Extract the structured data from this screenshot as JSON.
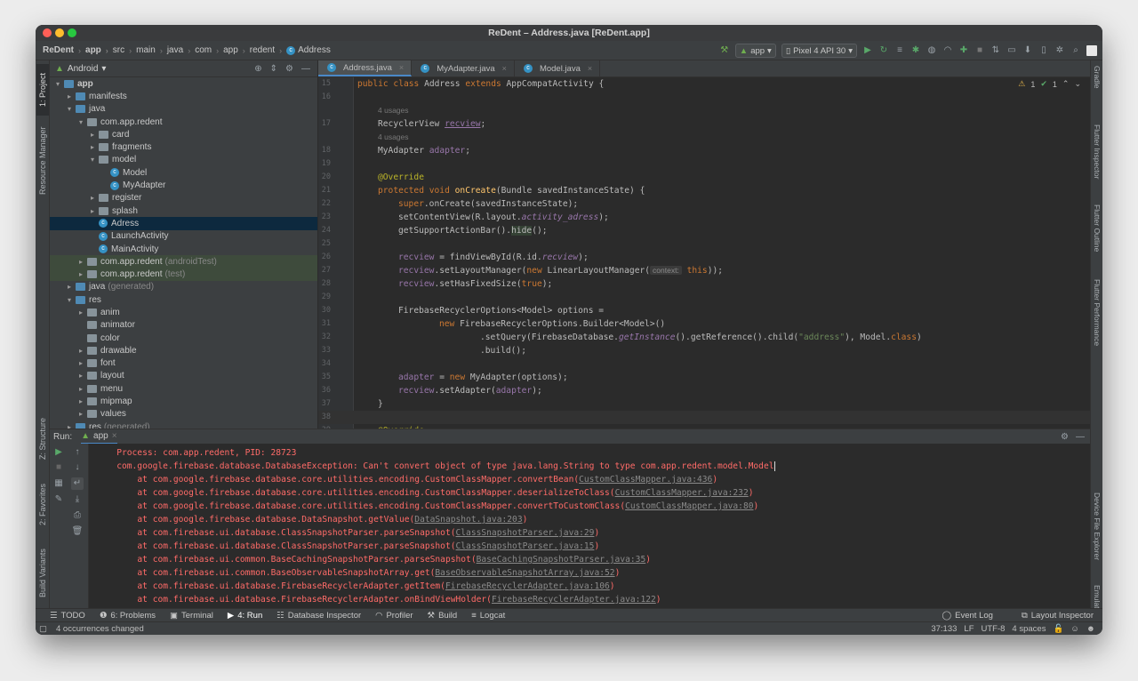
{
  "window": {
    "title": "ReDent – Address.java [ReDent.app]",
    "colors": {
      "close": "#ff5f57",
      "minimize": "#febc2e",
      "maximize": "#28c840",
      "accent": "#4a88c7",
      "error_text": "#ff6b68"
    }
  },
  "breadcrumbs": [
    "ReDent",
    "app",
    "src",
    "main",
    "java",
    "com",
    "app",
    "redent",
    "Address"
  ],
  "toolbar": {
    "run_config": "app",
    "device": "Pixel 4 API 30"
  },
  "left_stripe": {
    "tabs": [
      "1: Project",
      "Resource Manager",
      "Z: Structure",
      "2: Favorites",
      "Build Variants"
    ]
  },
  "right_stripe": {
    "tabs": [
      "Gradle",
      "Flutter Inspector",
      "Flutter Outline",
      "Flutter Performance",
      "Device File Explorer",
      "Emulator"
    ]
  },
  "project": {
    "view": "Android",
    "tree": [
      {
        "label": "app",
        "suffix": ""
      },
      {
        "label": "manifests",
        "suffix": ""
      },
      {
        "label": "java",
        "suffix": ""
      },
      {
        "label": "com.app.redent",
        "suffix": ""
      },
      {
        "label": "card",
        "suffix": ""
      },
      {
        "label": "fragments",
        "suffix": ""
      },
      {
        "label": "model",
        "suffix": ""
      },
      {
        "label": "Model",
        "suffix": ""
      },
      {
        "label": "MyAdapter",
        "suffix": ""
      },
      {
        "label": "register",
        "suffix": ""
      },
      {
        "label": "splash",
        "suffix": ""
      },
      {
        "label": "Adress",
        "suffix": ""
      },
      {
        "label": "LaunchActivity",
        "suffix": ""
      },
      {
        "label": "MainActivity",
        "suffix": ""
      },
      {
        "label": "com.app.redent",
        "suffix": "(androidTest)"
      },
      {
        "label": "com.app.redent",
        "suffix": "(test)"
      },
      {
        "label": "java",
        "suffix": "(generated)"
      },
      {
        "label": "res",
        "suffix": ""
      },
      {
        "label": "anim",
        "suffix": ""
      },
      {
        "label": "animator",
        "suffix": ""
      },
      {
        "label": "color",
        "suffix": ""
      },
      {
        "label": "drawable",
        "suffix": ""
      },
      {
        "label": "font",
        "suffix": ""
      },
      {
        "label": "layout",
        "suffix": ""
      },
      {
        "label": "menu",
        "suffix": ""
      },
      {
        "label": "mipmap",
        "suffix": ""
      },
      {
        "label": "values",
        "suffix": ""
      },
      {
        "label": "res",
        "suffix": "(generated)"
      }
    ]
  },
  "editor_tabs": [
    "Address.java",
    "MyAdapter.java",
    "Model.java"
  ],
  "inspections": {
    "warnings": "1",
    "ok": "1"
  },
  "code": {
    "line_numbers": [
      "15",
      "16",
      "",
      "17",
      "",
      "18",
      "19",
      "20",
      "21",
      "22",
      "23",
      "24",
      "25",
      "26",
      "27",
      "28",
      "29",
      "30",
      "31",
      "32",
      "33",
      "34",
      "35",
      "36",
      "37",
      "38",
      "39"
    ],
    "usages_4": "4 usages",
    "l15": {
      "kw1": "public class",
      "name": "Address",
      "kw2": "extends",
      "rest": "AppCompatActivity {"
    },
    "l17": {
      "type": "RecyclerView",
      "field": "recview",
      "end": ";"
    },
    "l18": {
      "type": "MyAdapter",
      "field": "adapter",
      "end": ";"
    },
    "l20": "@Override",
    "l21": {
      "kw": "protected void",
      "fn": "onCreate",
      "rest": "(Bundle savedInstanceState) {"
    },
    "l22": {
      "kw": "super",
      "rest": ".onCreate(savedInstanceState);"
    },
    "l23": {
      "a": "setContentView(R.layout.",
      "b": "activity_adress",
      "c": ");"
    },
    "l24": {
      "a": "getSupportActionBar().",
      "b": "hide",
      "c": "();"
    },
    "l26": {
      "f": "recview",
      "a": " = findViewById(R.id.",
      "b": "recview",
      "c": ");"
    },
    "l27": {
      "f": "recview",
      "a": ".setLayoutManager(",
      "kw": "new",
      "b": " LinearLayoutManager(",
      "hint": "context:",
      "kw2": "this",
      "c": "));"
    },
    "l28": {
      "f": "recview",
      "a": ".setHasFixedSize(",
      "kw": "true",
      "c": ");"
    },
    "l30": {
      "a": "FirebaseRecyclerOptions<Model> options ="
    },
    "l31": {
      "kw": "new",
      "a": " FirebaseRecyclerOptions.Builder<Model>()"
    },
    "l32": {
      "a": ".setQuery(FirebaseDatabase.",
      "b": "getInstance",
      "c": "().getReference().child(",
      "s": "\"address\"",
      "d": "), Model.",
      "kw": "class",
      "e": ")"
    },
    "l33": ".build();",
    "l35": {
      "f": "adapter",
      "a": " = ",
      "kw": "new",
      "b": " MyAdapter(options);"
    },
    "l36": {
      "f": "recview",
      "a": ".setAdapter(",
      "g": "adapter",
      "c": ");"
    },
    "l37": "}",
    "l39": "@Override"
  },
  "run": {
    "label": "Run:",
    "tab": "app",
    "lines": [
      {
        "text": "Process: com.app.redent, PID: 28723",
        "link": "",
        "tail": "",
        "indent": "    "
      },
      {
        "text": "com.google.firebase.database.DatabaseException: Can't convert object of type java.lang.String to type com.app.redent.model.Model",
        "link": "",
        "tail": "",
        "indent": "    "
      },
      {
        "text": "at com.google.firebase.database.core.utilities.encoding.CustomClassMapper.convertBean(",
        "link": "CustomClassMapper.java:436",
        "tail": ")",
        "indent": "        "
      },
      {
        "text": "at com.google.firebase.database.core.utilities.encoding.CustomClassMapper.deserializeToClass(",
        "link": "CustomClassMapper.java:232",
        "tail": ")",
        "indent": "        "
      },
      {
        "text": "at com.google.firebase.database.core.utilities.encoding.CustomClassMapper.convertToCustomClass(",
        "link": "CustomClassMapper.java:80",
        "tail": ")",
        "indent": "        "
      },
      {
        "text": "at com.google.firebase.database.DataSnapshot.getValue(",
        "link": "DataSnapshot.java:203",
        "tail": ")",
        "indent": "        "
      },
      {
        "text": "at com.firebase.ui.database.ClassSnapshotParser.parseSnapshot(",
        "link": "ClassSnapshotParser.java:29",
        "tail": ")",
        "indent": "        "
      },
      {
        "text": "at com.firebase.ui.database.ClassSnapshotParser.parseSnapshot(",
        "link": "ClassSnapshotParser.java:15",
        "tail": ")",
        "indent": "        "
      },
      {
        "text": "at com.firebase.ui.common.BaseCachingSnapshotParser.parseSnapshot(",
        "link": "BaseCachingSnapshotParser.java:35",
        "tail": ")",
        "indent": "        "
      },
      {
        "text": "at com.firebase.ui.common.BaseObservableSnapshotArray.get(",
        "link": "BaseObservableSnapshotArray.java:52",
        "tail": ")",
        "indent": "        "
      },
      {
        "text": "at com.firebase.ui.database.FirebaseRecyclerAdapter.getItem(",
        "link": "FirebaseRecyclerAdapter.java:106",
        "tail": ")",
        "indent": "        "
      },
      {
        "text": "at com.firebase.ui.database.FirebaseRecyclerAdapter.onBindViewHolder(",
        "link": "FirebaseRecyclerAdapter.java:122",
        "tail": ")",
        "indent": "        "
      }
    ]
  },
  "tool_windows": {
    "left": [
      "TODO",
      "6: Problems",
      "Terminal",
      "4: Run",
      "Database Inspector",
      "Profiler",
      "Build",
      "Logcat"
    ],
    "right": [
      "Event Log",
      "Layout Inspector"
    ]
  },
  "status": {
    "message": "4 occurrences changed",
    "position": "37:133",
    "line_sep": "LF",
    "encoding": "UTF-8",
    "indent": "4 spaces"
  }
}
